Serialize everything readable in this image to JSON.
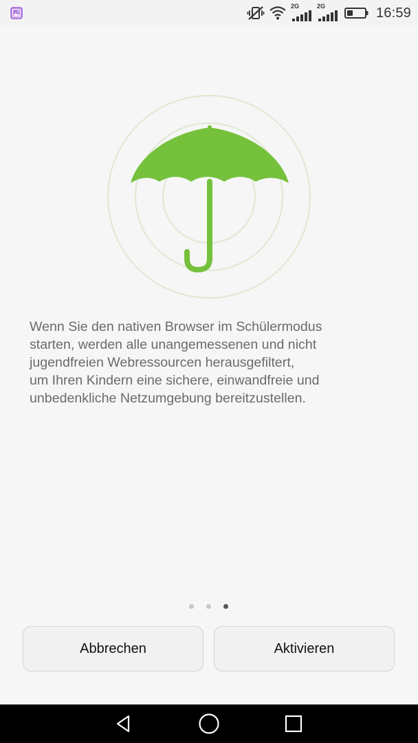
{
  "status_bar": {
    "time": "16:59",
    "network_1": "2G",
    "network_2": "2G"
  },
  "main": {
    "description": "Wenn Sie den nativen Browser im Schülermodus\nstarten, werden alle unangemessenen und nicht\njugendfreien Webressourcen herausgefiltert,\num Ihren Kindern eine sichere, einwandfreie und\nunbedenkliche Netzumgebung bereitzustellen.",
    "accent_color": "#76c13b",
    "pager": {
      "total": 3,
      "current": 3
    }
  },
  "buttons": {
    "cancel_label": "Abbrechen",
    "activate_label": "Aktivieren"
  },
  "navigation": {
    "icons": [
      "back-icon",
      "home-icon",
      "recent-apps-icon"
    ]
  }
}
